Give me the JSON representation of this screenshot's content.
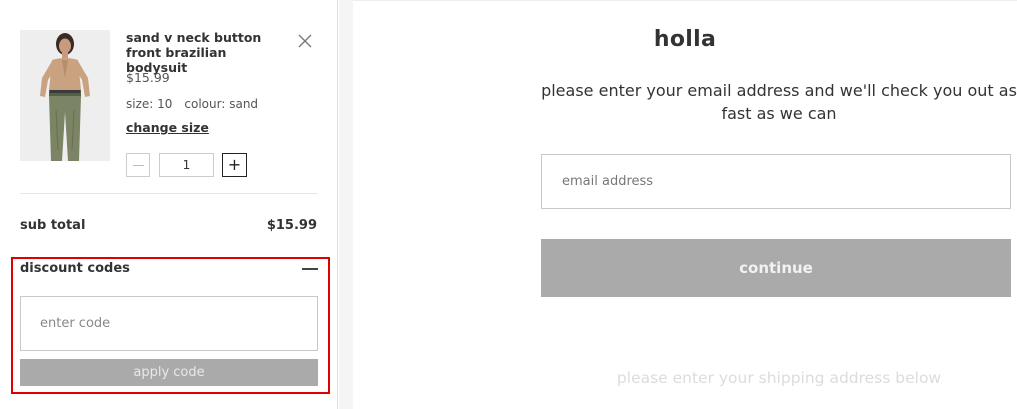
{
  "cart": {
    "item": {
      "name": "sand v neck button front brazilian bodysuit",
      "price": "$15.99",
      "size_label": "size: 10",
      "colour_label": "colour: sand",
      "change_size_label": "change size",
      "quantity": "1",
      "image_icon": "product-photo"
    },
    "subtotal_label": "sub total",
    "subtotal_value": "$15.99",
    "discount": {
      "label": "discount codes",
      "placeholder": "enter code",
      "apply_label": "apply code"
    },
    "partial_text": "... ... ... ... ... ..."
  },
  "checkout": {
    "greeting": "holla",
    "instructions": "please enter your email address and we'll check you out as fast as we can",
    "email_placeholder": "email address",
    "continue_label": "continue",
    "shipping_hint": "please enter your shipping address below"
  },
  "colors": {
    "highlight": "#e00000",
    "button_disabled": "#aaaaaa"
  }
}
